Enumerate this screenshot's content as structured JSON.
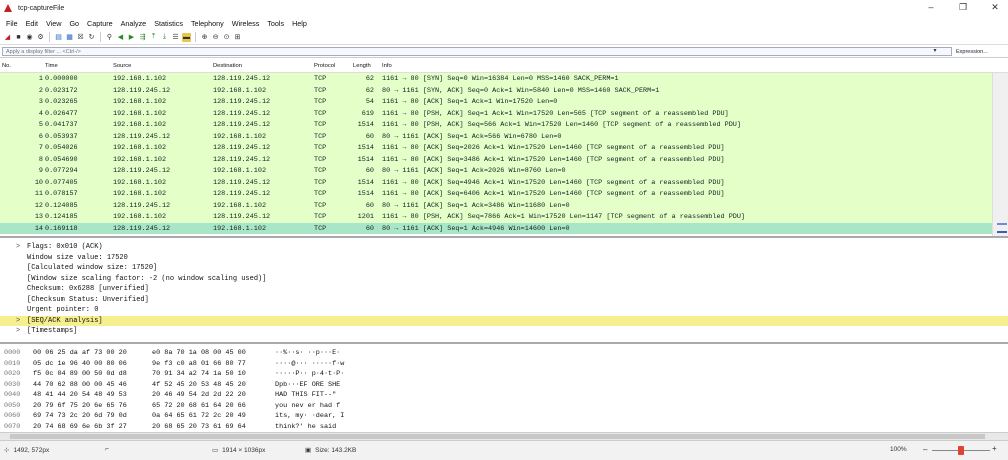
{
  "window": {
    "title": "tcp-captureFile",
    "controls": [
      "–",
      "❐",
      "✕"
    ]
  },
  "menu": [
    "File",
    "Edit",
    "View",
    "Go",
    "Capture",
    "Analyze",
    "Statistics",
    "Telephony",
    "Wireless",
    "Tools",
    "Help"
  ],
  "filter": {
    "placeholder": "Apply a display filter ... <Ctrl-/>",
    "expression_label": "Expression..."
  },
  "packet_list": {
    "columns": [
      "No.",
      "Time",
      "Source",
      "Destination",
      "Protocol",
      "Length",
      "Info"
    ],
    "rows": [
      {
        "no": "1",
        "time": "0.000000",
        "src": "192.168.1.102",
        "dst": "128.119.245.12",
        "proto": "TCP",
        "len": "62",
        "info": "1161 → 80 [SYN] Seq=0 Win=16384 Len=0 MSS=1460 SACK_PERM=1"
      },
      {
        "no": "2",
        "time": "0.023172",
        "src": "128.119.245.12",
        "dst": "192.168.1.102",
        "proto": "TCP",
        "len": "62",
        "info": "80 → 1161 [SYN, ACK] Seq=0 Ack=1 Win=5840 Len=0 MSS=1460 SACK_PERM=1"
      },
      {
        "no": "3",
        "time": "0.023265",
        "src": "192.168.1.102",
        "dst": "128.119.245.12",
        "proto": "TCP",
        "len": "54",
        "info": "1161 → 80 [ACK] Seq=1 Ack=1 Win=17520 Len=0"
      },
      {
        "no": "4",
        "time": "0.026477",
        "src": "192.168.1.102",
        "dst": "128.119.245.12",
        "proto": "TCP",
        "len": "619",
        "info": "1161 → 80 [PSH, ACK] Seq=1 Ack=1 Win=17520 Len=565 [TCP segment of a reassembled PDU]"
      },
      {
        "no": "5",
        "time": "0.041737",
        "src": "192.168.1.102",
        "dst": "128.119.245.12",
        "proto": "TCP",
        "len": "1514",
        "info": "1161 → 80 [PSH, ACK] Seq=566 Ack=1 Win=17520 Len=1460 [TCP segment of a reassembled PDU]"
      },
      {
        "no": "6",
        "time": "0.053937",
        "src": "128.119.245.12",
        "dst": "192.168.1.102",
        "proto": "TCP",
        "len": "60",
        "info": "80 → 1161 [ACK] Seq=1 Ack=566 Win=6780 Len=0"
      },
      {
        "no": "7",
        "time": "0.054026",
        "src": "192.168.1.102",
        "dst": "128.119.245.12",
        "proto": "TCP",
        "len": "1514",
        "info": "1161 → 80 [ACK] Seq=2026 Ack=1 Win=17520 Len=1460 [TCP segment of a reassembled PDU]"
      },
      {
        "no": "8",
        "time": "0.054690",
        "src": "192.168.1.102",
        "dst": "128.119.245.12",
        "proto": "TCP",
        "len": "1514",
        "info": "1161 → 80 [ACK] Seq=3486 Ack=1 Win=17520 Len=1460 [TCP segment of a reassembled PDU]"
      },
      {
        "no": "9",
        "time": "0.077294",
        "src": "128.119.245.12",
        "dst": "192.168.1.102",
        "proto": "TCP",
        "len": "60",
        "info": "80 → 1161 [ACK] Seq=1 Ack=2026 Win=8760 Len=0"
      },
      {
        "no": "10",
        "time": "0.077405",
        "src": "192.168.1.102",
        "dst": "128.119.245.12",
        "proto": "TCP",
        "len": "1514",
        "info": "1161 → 80 [ACK] Seq=4946 Ack=1 Win=17520 Len=1460 [TCP segment of a reassembled PDU]"
      },
      {
        "no": "11",
        "time": "0.078157",
        "src": "192.168.1.102",
        "dst": "128.119.245.12",
        "proto": "TCP",
        "len": "1514",
        "info": "1161 → 80 [ACK] Seq=6406 Ack=1 Win=17520 Len=1460 [TCP segment of a reassembled PDU]"
      },
      {
        "no": "12",
        "time": "0.124085",
        "src": "128.119.245.12",
        "dst": "192.168.1.102",
        "proto": "TCP",
        "len": "60",
        "info": "80 → 1161 [ACK] Seq=1 Ack=3486 Win=11680 Len=0"
      },
      {
        "no": "13",
        "time": "0.124185",
        "src": "192.168.1.102",
        "dst": "128.119.245.12",
        "proto": "TCP",
        "len": "1201",
        "info": "1161 → 80 [PSH, ACK] Seq=7866 Ack=1 Win=17520 Len=1147 [TCP segment of a reassembled PDU]"
      },
      {
        "no": "14",
        "time": "0.169118",
        "src": "128.119.245.12",
        "dst": "192.168.1.102",
        "proto": "TCP",
        "len": "60",
        "info": "80 → 1161 [ACK] Seq=1 Ack=4946 Win=14600 Len=0"
      }
    ]
  },
  "details": [
    {
      "arrow": ">",
      "text": "Flags: 0x010 (ACK)"
    },
    {
      "arrow": "",
      "text": "Window size value: 17520"
    },
    {
      "arrow": "",
      "text": "[Calculated window size: 17520]"
    },
    {
      "arrow": "",
      "text": "[Window size scaling factor: -2 (no window scaling used)]"
    },
    {
      "arrow": "",
      "text": "Checksum: 0x6288 [unverified]"
    },
    {
      "arrow": "",
      "text": "[Checksum Status: Unverified]"
    },
    {
      "arrow": "",
      "text": "Urgent pointer: 0"
    },
    {
      "arrow": ">",
      "text": "[SEQ/ACK analysis]"
    },
    {
      "arrow": ">",
      "text": "[Timestamps]"
    }
  ],
  "hex": [
    {
      "off": "0000",
      "b1": "00 06 25 da af 73 00 20",
      "b2": "e0 8a 70 1a 08 00 45 00",
      "asc": "··%··s· ··p···E·"
    },
    {
      "off": "0010",
      "b1": "05 dc 1e 96 40 00 80 06",
      "b2": "9e f3 c0 a8 01 66 80 77",
      "asc": "····@··· ·····f·w"
    },
    {
      "off": "0020",
      "b1": "f5 0c 04 89 00 50 0d d8",
      "b2": "70 91 34 a2 74 1a 50 10",
      "asc": "·····P·· p·4·t·P·"
    },
    {
      "off": "0030",
      "b1": "44 70 62 88 00 00 45 46",
      "b2": "4f 52 45 20 53 48 45 20",
      "asc": "Dpb···EF ORE SHE "
    },
    {
      "off": "0040",
      "b1": "48 41 44 20 54 48 49 53",
      "b2": "20 46 49 54 2d 2d 22 20",
      "asc": "HAD THIS  FIT--\" "
    },
    {
      "off": "0050",
      "b1": "20 79 6f 75 20 6e 65 76",
      "b2": "65 72 20 68 61 64 20 66",
      "asc": " you nev er had f"
    },
    {
      "off": "0060",
      "b1": "69 74 73 2c 20 6d 79 0d",
      "b2": "0a 64 65 61 72 2c 20 49",
      "asc": "its, my· ·dear, I"
    },
    {
      "off": "0070",
      "b1": "20 74 68 69 6e 6b 3f 27",
      "b2": "20 68 65 20 73 61 69 64",
      "asc": " think?' he said"
    }
  ],
  "status": {
    "coords": "1492, 572px",
    "dimensions": "1914 × 1036px",
    "size": "Size: 143.2KB",
    "zoom": "100%"
  }
}
